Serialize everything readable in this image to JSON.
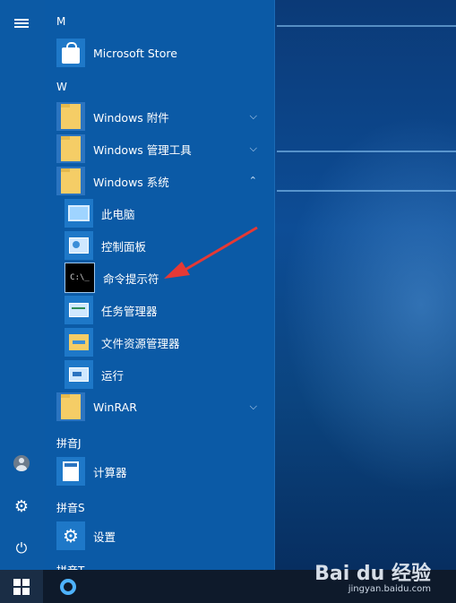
{
  "start_menu": {
    "sections": [
      {
        "letter": "M"
      },
      {
        "letter": "W"
      },
      {
        "letter": "拼音J"
      },
      {
        "letter": "拼音S"
      },
      {
        "letter": "拼音T"
      }
    ],
    "items": {
      "microsoft_store": "Microsoft Store",
      "windows_accessories": "Windows 附件",
      "windows_admin_tools": "Windows 管理工具",
      "windows_system": "Windows 系统",
      "this_pc": "此电脑",
      "control_panel": "控制面板",
      "command_prompt": "命令提示符",
      "task_manager": "任务管理器",
      "file_explorer": "文件资源管理器",
      "run": "运行",
      "winrar": "WinRAR",
      "calculator": "计算器",
      "settings": "设置"
    },
    "chevrons": {
      "collapsed": "⌵",
      "expanded": "⌃"
    },
    "cmd_icon_text": "C:\\_"
  },
  "watermark": {
    "brand": "Bai du 经验",
    "url": "jingyan.baidu.com"
  },
  "colors": {
    "menu_bg": "#0b5aa6",
    "tile": "#1e78c8",
    "folder": "#f5cd66",
    "arrow": "#e53935",
    "taskbar": "#0e1a2b"
  }
}
